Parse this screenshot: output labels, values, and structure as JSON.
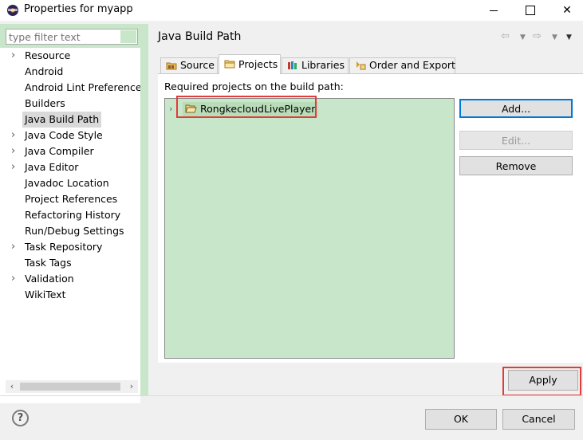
{
  "window": {
    "title": "Properties for myapp"
  },
  "filter": {
    "placeholder": "type filter text"
  },
  "tree": {
    "items": [
      {
        "label": "Resource",
        "expandable": true
      },
      {
        "label": "Android",
        "expandable": false
      },
      {
        "label": "Android Lint Preferences",
        "expandable": false
      },
      {
        "label": "Builders",
        "expandable": false
      },
      {
        "label": "Java Build Path",
        "expandable": false,
        "selected": true
      },
      {
        "label": "Java Code Style",
        "expandable": true
      },
      {
        "label": "Java Compiler",
        "expandable": true
      },
      {
        "label": "Java Editor",
        "expandable": true
      },
      {
        "label": "Javadoc Location",
        "expandable": false
      },
      {
        "label": "Project References",
        "expandable": false
      },
      {
        "label": "Refactoring History",
        "expandable": false
      },
      {
        "label": "Run/Debug Settings",
        "expandable": false
      },
      {
        "label": "Task Repository",
        "expandable": true
      },
      {
        "label": "Task Tags",
        "expandable": false
      },
      {
        "label": "Validation",
        "expandable": true
      },
      {
        "label": "WikiText",
        "expandable": false
      }
    ]
  },
  "page": {
    "title": "Java Build Path"
  },
  "tabs": [
    {
      "label": "Source",
      "icon": "source-folder-icon"
    },
    {
      "label": "Projects",
      "icon": "folder-icon",
      "active": true
    },
    {
      "label": "Libraries",
      "icon": "library-icon"
    },
    {
      "label": "Order and Export",
      "icon": "order-export-icon"
    }
  ],
  "projects": {
    "label": "Required projects on the build path:",
    "items": [
      {
        "label": "RongkecloudLivePlayer"
      }
    ]
  },
  "buttons": {
    "add": "Add...",
    "edit": "Edit...",
    "remove": "Remove",
    "apply": "Apply",
    "ok": "OK",
    "cancel": "Cancel",
    "help": "?"
  },
  "colors": {
    "highlight": "#e03c3c",
    "green_bg": "#c8e6c9",
    "default_button_border": "#0078d7"
  }
}
